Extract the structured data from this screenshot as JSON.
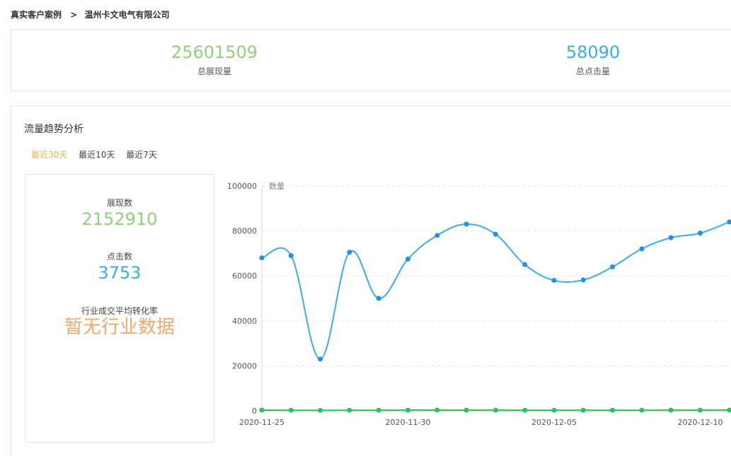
{
  "breadcrumb": {
    "parent": "真实客户案例",
    "separator": ">",
    "current": "温州卡文电气有限公司"
  },
  "totals": {
    "impressions_value": "25601509",
    "impressions_label": "总展现量",
    "clicks_value": "58090",
    "clicks_label": "总点击量"
  },
  "trend": {
    "title": "流量趋势分析",
    "ranges": [
      "最近30天",
      "最近10天",
      "最近7天"
    ],
    "active_range": "最近30天"
  },
  "summary": {
    "impressions_label": "展现数",
    "impressions_value": "2152910",
    "clicks_label": "点击数",
    "clicks_value": "3753",
    "conversion_label": "行业成交平均转化率",
    "conversion_value": "暂无行业数据"
  },
  "colors": {
    "impressions": "#8fcf7f",
    "clicks": "#3aaee6",
    "accent": "#e9b44c",
    "no_data": "#f0a76c"
  },
  "chart_data": {
    "type": "line",
    "ylabel": "数量",
    "ylim": [
      0,
      100000
    ],
    "yticks": [
      0,
      20000,
      40000,
      60000,
      80000,
      100000
    ],
    "x": [
      "2020-11-25",
      "2020-11-26",
      "2020-11-27",
      "2020-11-28",
      "2020-11-29",
      "2020-11-30",
      "2020-12-01",
      "2020-12-02",
      "2020-12-03",
      "2020-12-04",
      "2020-12-05",
      "2020-12-06",
      "2020-12-07",
      "2020-12-08",
      "2020-12-09",
      "2020-12-10",
      "2020-12-11"
    ],
    "xtick_labels": [
      "2020-11-25",
      "2020-11-30",
      "2020-12-05",
      "2020-12-10"
    ],
    "grid": true,
    "series": [
      {
        "color": "#3aaee6",
        "values": [
          68000,
          69000,
          23000,
          70500,
          50000,
          67500,
          78000,
          83000,
          78500,
          65000,
          58000,
          58200,
          64000,
          72000,
          77000,
          79000,
          84000
        ]
      },
      {
        "color": "#27c15f",
        "values": [
          300,
          250,
          200,
          250,
          250,
          280,
          300,
          280,
          260,
          240,
          220,
          230,
          240,
          250,
          260,
          280,
          300
        ]
      },
      {
        "color": "#f0b07a",
        "values": [
          150,
          150,
          100,
          120,
          130,
          140,
          150,
          140,
          130,
          120,
          110,
          120,
          130,
          140,
          150,
          160,
          170
        ]
      }
    ]
  }
}
